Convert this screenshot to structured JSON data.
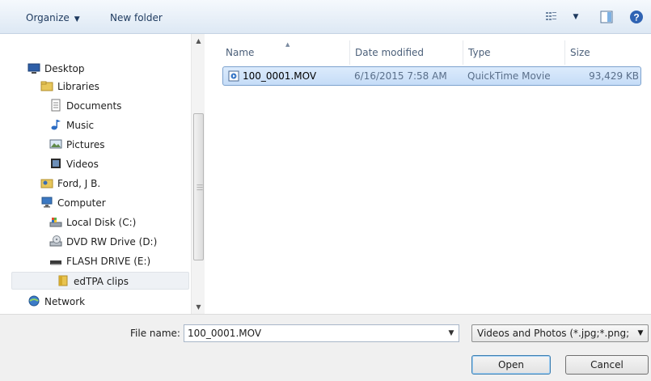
{
  "toolbar": {
    "organize_label": "Organize",
    "new_folder_label": "New folder",
    "icons": {
      "views": "change-view-icon",
      "preview": "preview-pane-icon",
      "help": "help-icon"
    }
  },
  "nav": {
    "items": [
      {
        "label": "Desktop",
        "icon": "desktop-icon"
      },
      {
        "label": "Libraries",
        "icon": "libraries-icon"
      },
      {
        "label": "Documents",
        "icon": "documents-icon"
      },
      {
        "label": "Music",
        "icon": "music-icon"
      },
      {
        "label": "Pictures",
        "icon": "pictures-icon"
      },
      {
        "label": "Videos",
        "icon": "videos-icon"
      },
      {
        "label": "Ford, J B.",
        "icon": "user-folder-icon"
      },
      {
        "label": "Computer",
        "icon": "computer-icon"
      },
      {
        "label": "Local Disk (C:)",
        "icon": "local-disk-icon"
      },
      {
        "label": "DVD RW Drive (D:)",
        "icon": "dvd-drive-icon"
      },
      {
        "label": "FLASH DRIVE (E:)",
        "icon": "flash-drive-icon"
      },
      {
        "label": "edTPA clips",
        "icon": "folder-icon",
        "selected": true
      },
      {
        "label": "Network",
        "icon": "network-icon"
      }
    ]
  },
  "filelist": {
    "columns": [
      "Name",
      "Date modified",
      "Type",
      "Size"
    ],
    "sorted_by": "Name",
    "rows": [
      {
        "name": "100_0001.MOV",
        "date": "6/16/2015 7:58 AM",
        "type": "QuickTime Movie",
        "size": "93,429 KB",
        "selected": true
      }
    ]
  },
  "footer": {
    "file_name_label": "File name:",
    "file_name_value": "100_0001.MOV",
    "file_type_value": "Videos and Photos (*.jpg;*.png;",
    "open_label": "Open",
    "cancel_label": "Cancel"
  },
  "colors": {
    "toolbar_top": "#f5f9fd",
    "toolbar_bottom": "#dde8f4",
    "selection_fill": "#cfe3fa",
    "selection_border": "#7da2ce"
  }
}
